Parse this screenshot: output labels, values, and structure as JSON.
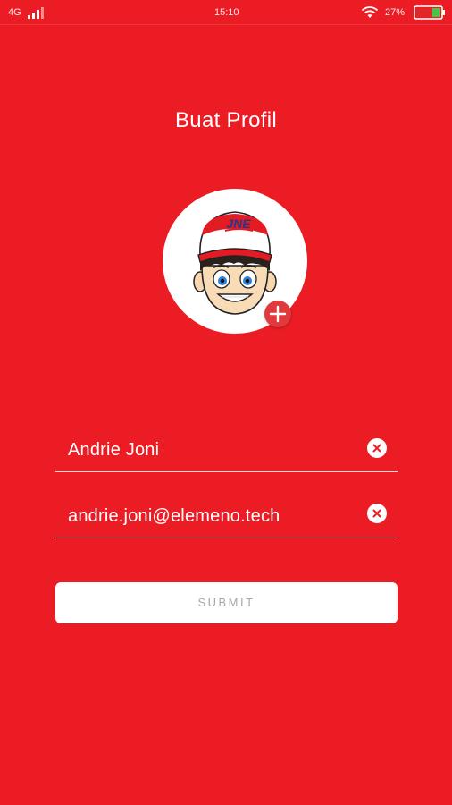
{
  "status_bar": {
    "network": "4G",
    "time": "15:10",
    "battery": "27%"
  },
  "page": {
    "title": "Buat Profil"
  },
  "avatar": {
    "cap_text": "JNE"
  },
  "form": {
    "name_value": "Andrie Joni",
    "email_value": "andrie.joni@elemeno.tech",
    "submit_label": "SUBMIT"
  },
  "colors": {
    "background": "#ec1c24",
    "button_text": "#a8a8a8",
    "add_badge": "#e03a3e"
  },
  "icons": {
    "signal": "signal-icon",
    "wifi": "wifi-icon",
    "battery": "battery-icon",
    "add": "plus-icon",
    "clear": "close-icon"
  }
}
